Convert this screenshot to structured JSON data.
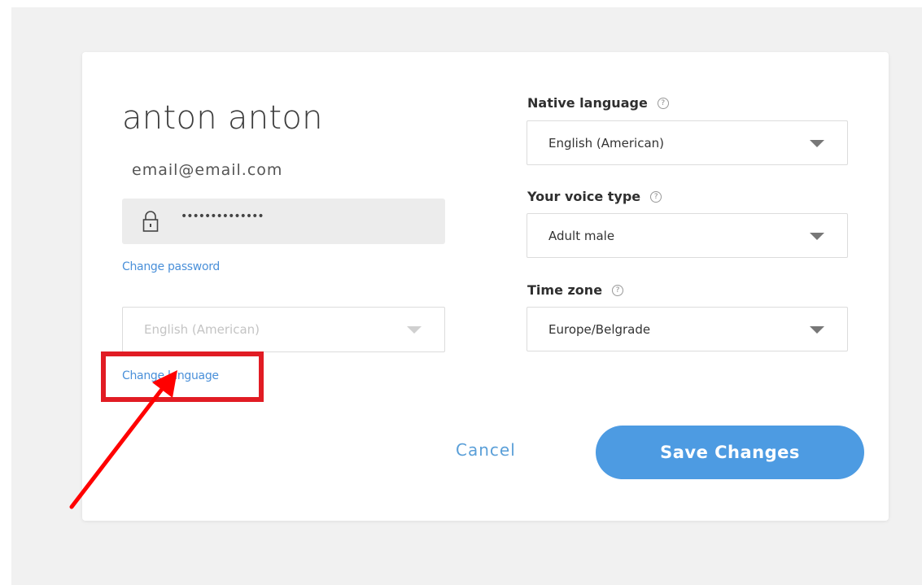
{
  "profile": {
    "name": "anton anton",
    "email": "email@email.com",
    "password_masked": "••••••••••••••",
    "change_password_label": "Change password",
    "language_select_value": "English (American)",
    "change_language_label": "Change language"
  },
  "settings": {
    "native_language": {
      "label": "Native language",
      "value": "English (American)"
    },
    "voice_type": {
      "label": "Your voice type",
      "value": "Adult male"
    },
    "time_zone": {
      "label": "Time zone",
      "value": "Europe/Belgrade"
    },
    "help_glyph": "?"
  },
  "actions": {
    "cancel_label": "Cancel",
    "save_label": "Save Changes"
  },
  "annotation": {
    "highlight_color": "#e11c24",
    "arrow_color": "#ff0000"
  },
  "colors": {
    "link": "#4a90d9",
    "primary_button": "#4d9be2"
  }
}
